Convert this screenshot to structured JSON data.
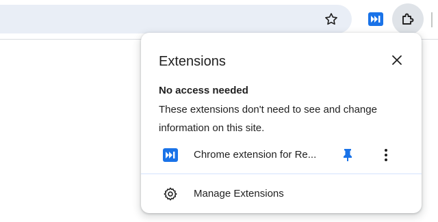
{
  "toolbar": {
    "star_icon": "star-outline-icon",
    "extension_icon": "fast-forward-icon",
    "puzzle_icon": "puzzle-piece-icon"
  },
  "popup": {
    "title": "Extensions",
    "close_icon": "close-icon",
    "section": {
      "heading": "No access needed",
      "description": "These extensions don't need to see and change information on this site."
    },
    "extensions": [
      {
        "name": "Chrome extension for Re...",
        "icon": "fast-forward-icon",
        "pinned": true,
        "pin_icon": "pin-icon",
        "menu_icon": "more-vertical-icon"
      }
    ],
    "manage": {
      "label": "Manage Extensions",
      "icon": "gear-icon"
    }
  },
  "colors": {
    "accent": "#1a73e8",
    "omnibox_bg": "#e9eef6",
    "active_button_bg": "#dfe3e8",
    "divider": "#d3e3fd",
    "text": "#1f1f1f"
  }
}
